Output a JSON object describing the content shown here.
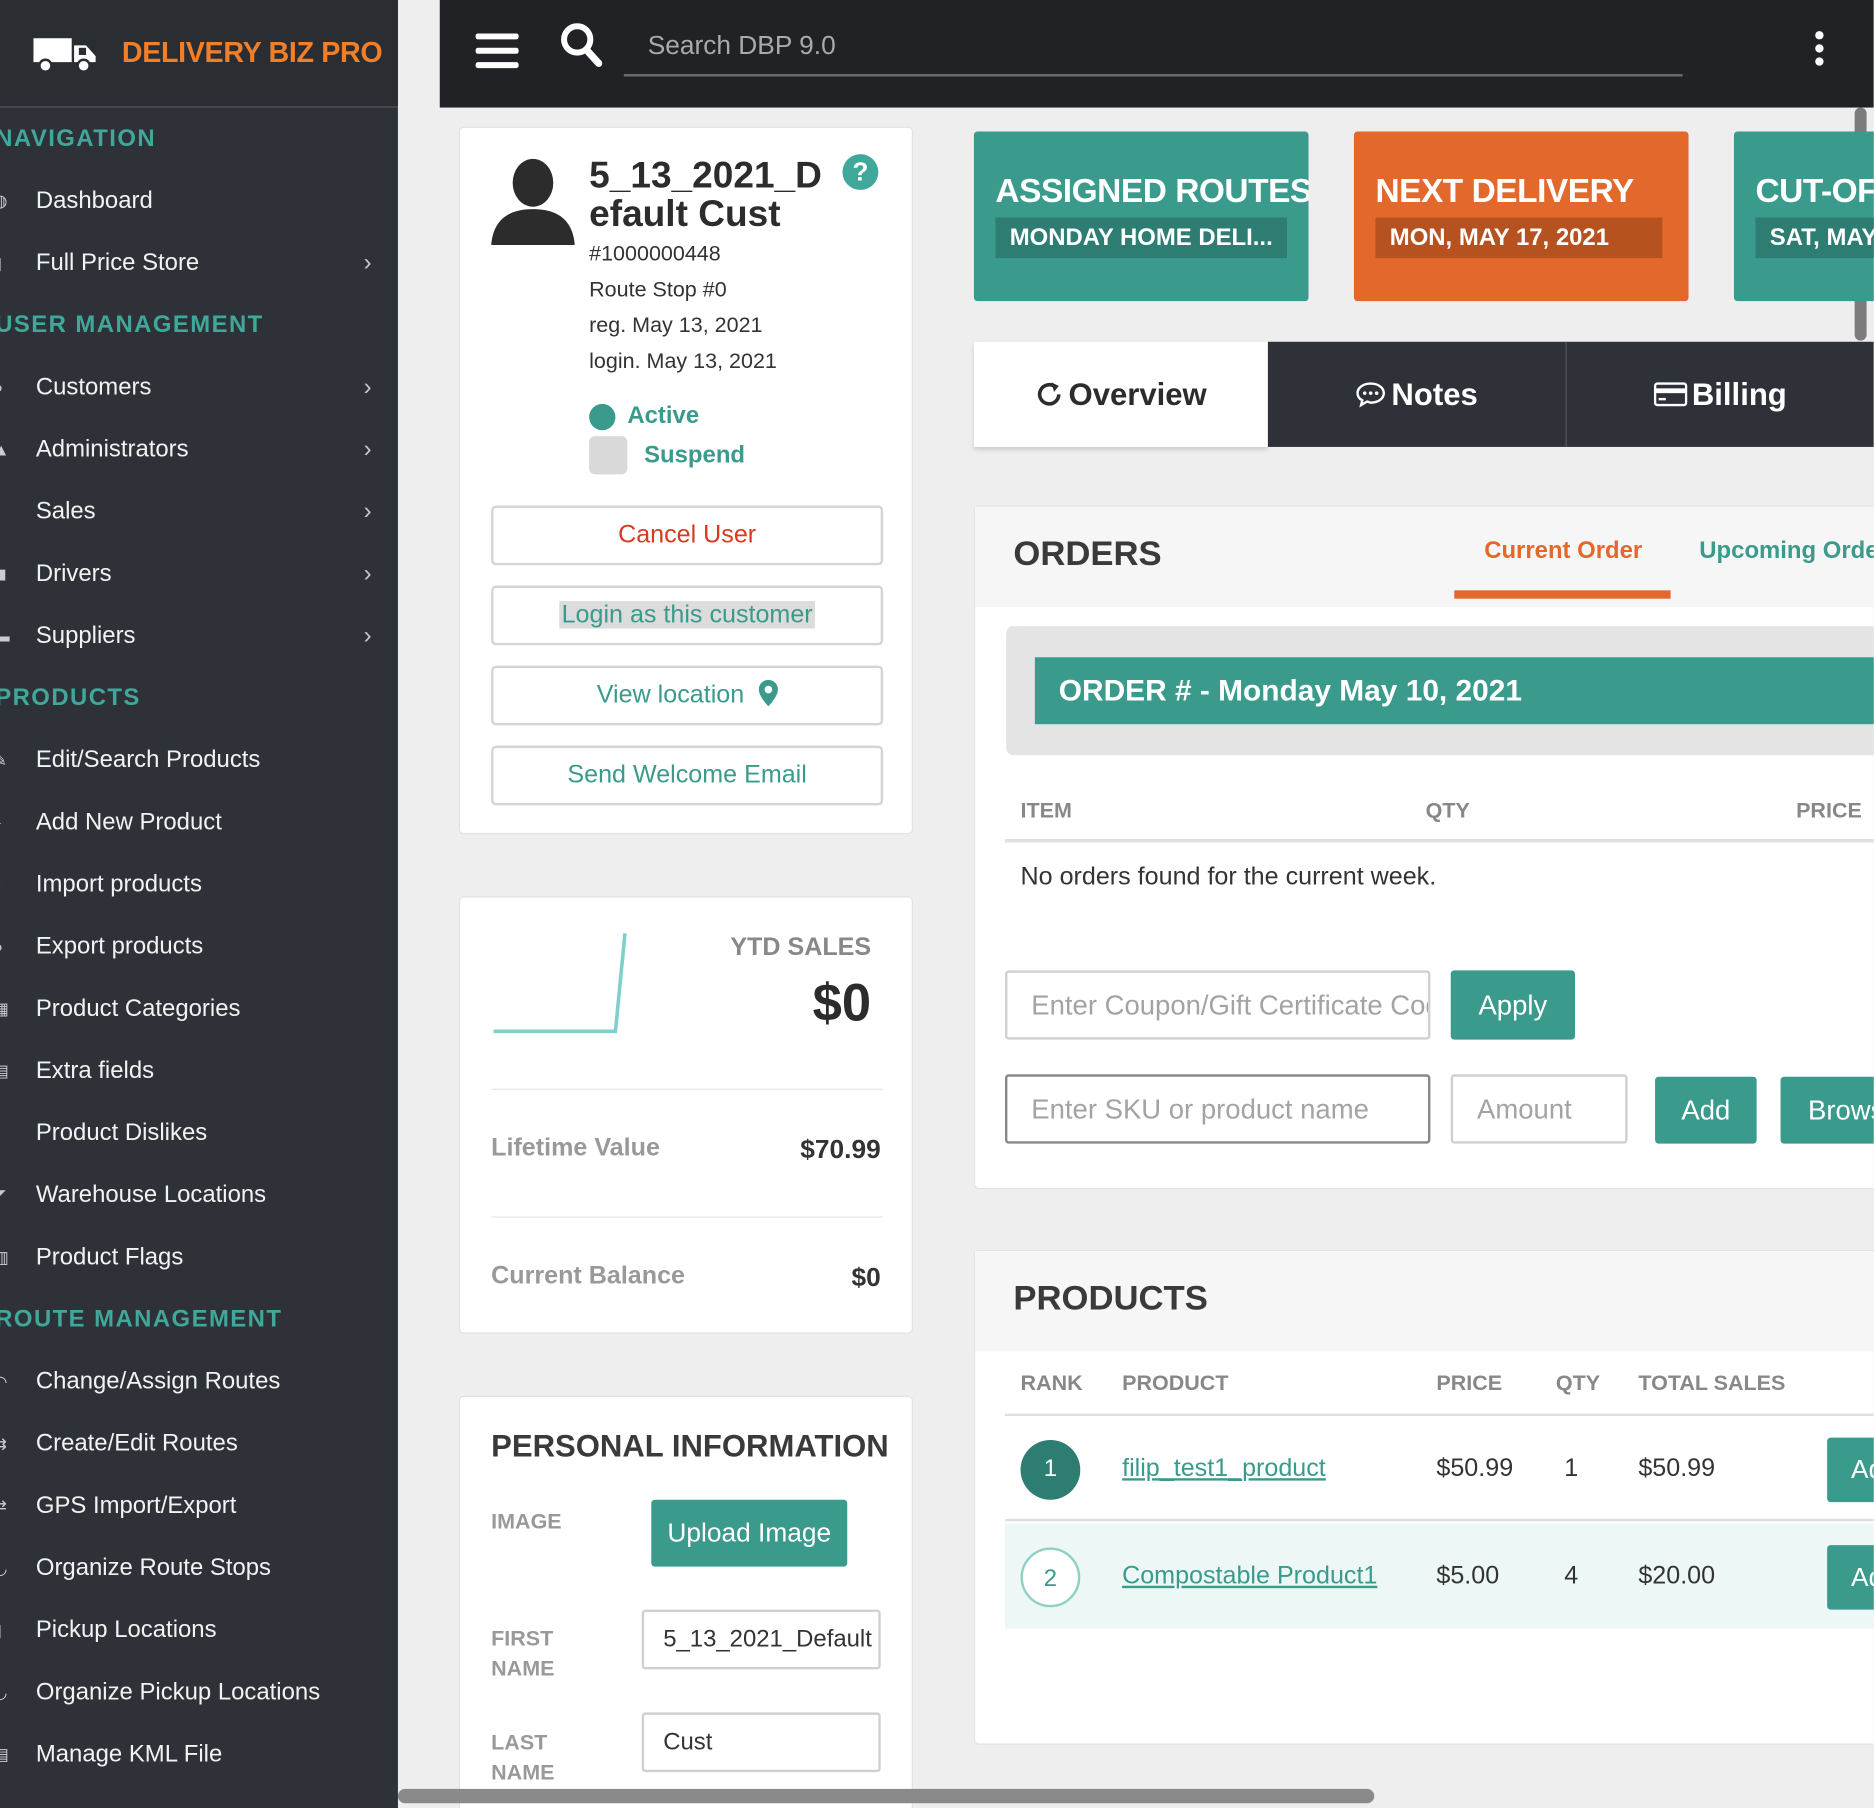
{
  "brand": {
    "name": "DELIVERY BIZ PRO",
    "logo_icon": "truck-icon"
  },
  "topbar": {
    "search_placeholder": "Search DBP 9.0"
  },
  "sidebar": {
    "sections": [
      {
        "title": "NAVIGATION",
        "items": [
          {
            "label": "Dashboard",
            "chevron": false
          },
          {
            "label": "Full Price Store",
            "chevron": true
          }
        ]
      },
      {
        "title": "USER MANAGEMENT",
        "items": [
          {
            "label": "Customers",
            "chevron": true
          },
          {
            "label": "Administrators",
            "chevron": true
          },
          {
            "label": "Sales",
            "chevron": true
          },
          {
            "label": "Drivers",
            "chevron": true
          },
          {
            "label": "Suppliers",
            "chevron": true
          }
        ]
      },
      {
        "title": "PRODUCTS",
        "items": [
          {
            "label": "Edit/Search Products",
            "chevron": false
          },
          {
            "label": "Add New Product",
            "chevron": false
          },
          {
            "label": "Import products",
            "chevron": false
          },
          {
            "label": "Export products",
            "chevron": false
          },
          {
            "label": "Product Categories",
            "chevron": false
          },
          {
            "label": "Extra fields",
            "chevron": false
          },
          {
            "label": "Product Dislikes",
            "chevron": false
          },
          {
            "label": "Warehouse Locations",
            "chevron": false
          },
          {
            "label": "Product Flags",
            "chevron": false
          }
        ]
      },
      {
        "title": "ROUTE MANAGEMENT",
        "items": [
          {
            "label": "Change/Assign Routes",
            "chevron": false
          },
          {
            "label": "Create/Edit Routes",
            "chevron": false
          },
          {
            "label": "GPS Import/Export",
            "chevron": false
          },
          {
            "label": "Organize Route Stops",
            "chevron": false
          },
          {
            "label": "Pickup Locations",
            "chevron": false
          },
          {
            "label": "Organize Pickup Locations",
            "chevron": false
          },
          {
            "label": "Manage KML File",
            "chevron": false
          }
        ]
      }
    ]
  },
  "profile": {
    "name": "5_13_2021_Default Cust",
    "id": "#1000000448",
    "route_stop": "Route Stop #0",
    "registered": "reg. May 13, 2021",
    "login": "login. May 13, 2021",
    "status_active": "Active",
    "status_suspend": "Suspend",
    "cancel_label": "Cancel User",
    "login_as_label": "Login as this customer",
    "view_location_label": "View location",
    "welcome_email_label": "Send Welcome Email"
  },
  "ytd": {
    "label": "YTD SALES",
    "value": "$0",
    "lifetime_label": "Lifetime Value",
    "lifetime_value": "$70.99",
    "balance_label": "Current Balance",
    "balance_value": "$0"
  },
  "personal": {
    "title": "PERSONAL INFORMATION",
    "image_label": "IMAGE",
    "upload_label": "Upload Image",
    "first_name_label": "FIRST NAME",
    "first_name_value": "5_13_2021_Default",
    "last_name_label": "LAST NAME",
    "last_name_value": "Cust"
  },
  "tiles": [
    {
      "title": "ASSIGNED ROUTES",
      "sub": "MONDAY HOME DELI...",
      "color": "#3a9a8c",
      "sub_color": "#2e7d72"
    },
    {
      "title": "NEXT DELIVERY",
      "sub": "MON, MAY 17, 2021",
      "color": "#e2682c",
      "sub_color": "#b5521f"
    },
    {
      "title": "CUT-OFF",
      "sub": "SAT, MAY",
      "color": "#3a9a8c",
      "sub_color": "#2e7d72"
    }
  ],
  "tabs": [
    {
      "label": "Overview",
      "icon": "refresh-icon",
      "active": true
    },
    {
      "label": "Notes",
      "icon": "chat-icon",
      "active": false
    },
    {
      "label": "Billing",
      "icon": "credit-card-icon",
      "active": false
    }
  ],
  "orders": {
    "title": "ORDERS",
    "tab_current": "Current Order",
    "tab_upcoming": "Upcoming Orders",
    "band": "ORDER # - Monday May 10, 2021",
    "col_item": "ITEM",
    "col_qty": "QTY",
    "col_price": "PRICE",
    "empty": "No orders found for the current week.",
    "coupon_placeholder": "Enter Coupon/Gift Certificate Code",
    "apply_label": "Apply",
    "sku_placeholder": "Enter SKU or product name",
    "amount_placeholder": "Amount",
    "add_label": "Add",
    "browse_label": "Browse"
  },
  "products": {
    "title": "PRODUCTS",
    "headers": {
      "rank": "RANK",
      "product": "PRODUCT",
      "price": "PRICE",
      "qty": "QTY",
      "total": "TOTAL SALES"
    },
    "rows": [
      {
        "rank": "1",
        "name": "filip_test1_product",
        "price": "$50.99",
        "qty": "1",
        "total": "$50.99",
        "action": "Add"
      },
      {
        "rank": "2",
        "name": "Compostable Product1",
        "price": "$5.00",
        "qty": "4",
        "total": "$20.00",
        "action": "Add"
      }
    ]
  }
}
